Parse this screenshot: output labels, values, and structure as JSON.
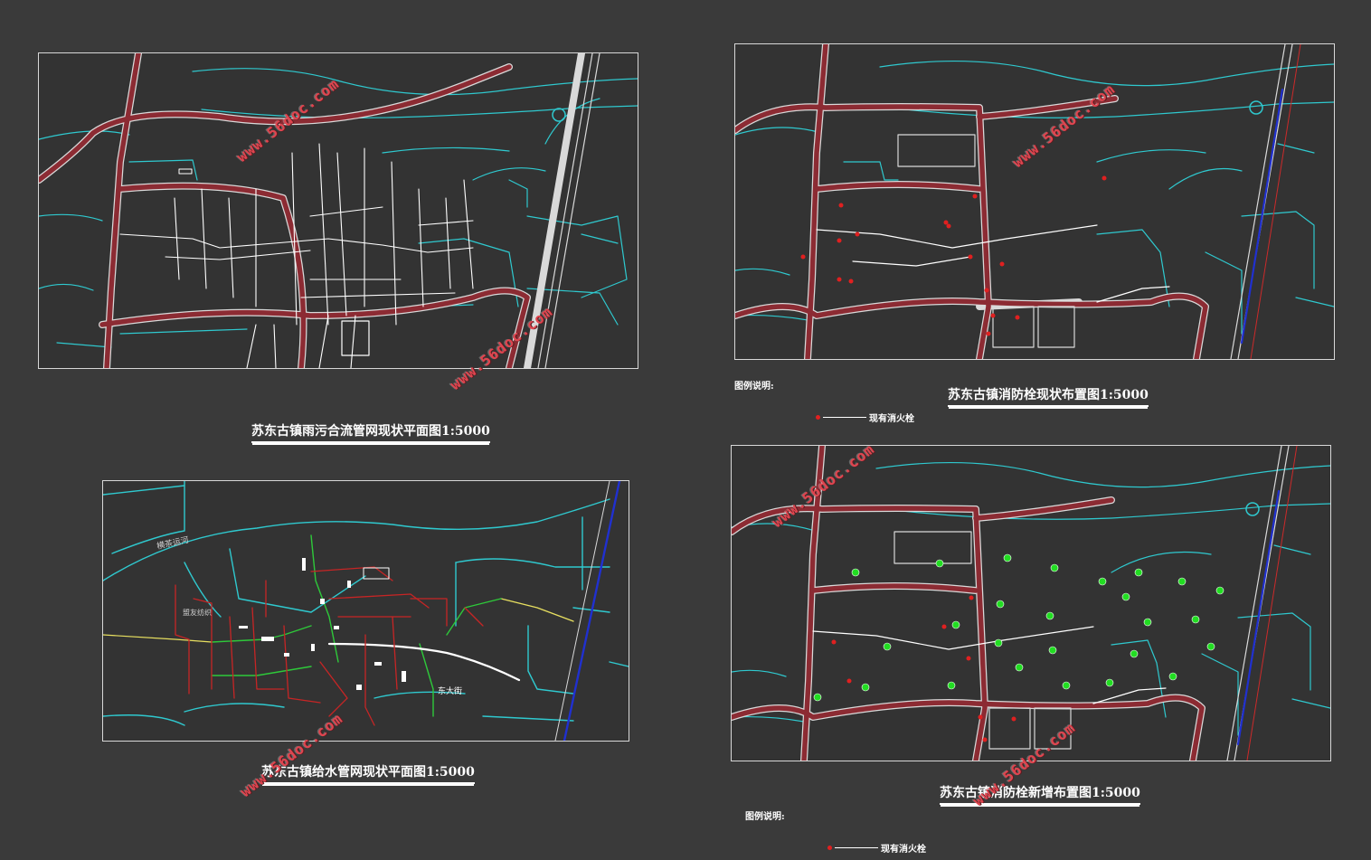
{
  "maps": {
    "sewer": {
      "title": "苏东古镇雨污合流管网现状平面图1:5000"
    },
    "hydrant_current": {
      "title": "苏东古镇消防栓现状布置图1:5000",
      "legend_heading": "图例说明:",
      "legend_item": "现有消火栓"
    },
    "water_supply": {
      "title": "苏东古镇给水管网现状平面图1:5000",
      "label_canal": "横茶运河",
      "label_street": "东大街",
      "label_factory": "盟友纺织"
    },
    "hydrant_new": {
      "title": "苏东古镇消防栓新增布置图1:5000",
      "legend_heading": "图例说明:",
      "legend_item": "现有消火栓"
    }
  },
  "watermark_text": "www.56doc.com",
  "colors": {
    "background": "#3a3a3a",
    "road": "#8c2b33",
    "road_edge": "#d9d9d9",
    "water": "#2fc9cf",
    "hydrant_existing": "#e02020",
    "hydrant_new": "#22dd22",
    "highway": "#2030d0",
    "watermark": "#e0454f"
  }
}
